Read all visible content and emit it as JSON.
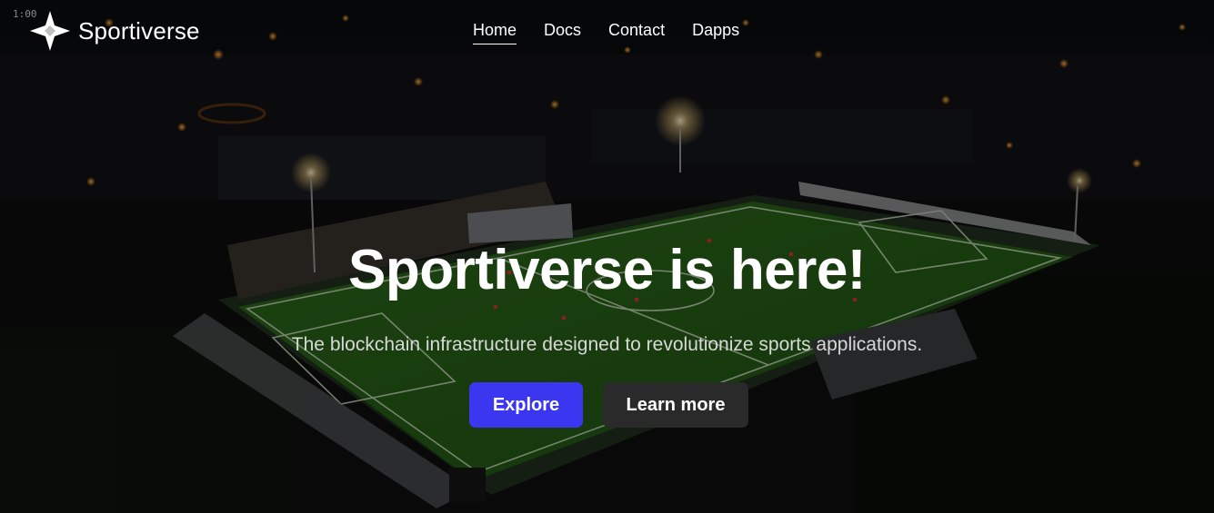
{
  "overlay_timestamp": "1:00",
  "brand": {
    "name": "Sportiverse",
    "logo_icon": "four-point-star-icon"
  },
  "nav": {
    "items": [
      {
        "label": "Home",
        "active": true
      },
      {
        "label": "Docs",
        "active": false
      },
      {
        "label": "Contact",
        "active": false
      },
      {
        "label": "Dapps",
        "active": false
      }
    ]
  },
  "hero": {
    "title": "Sportiverse is here!",
    "subtitle": "The blockchain infrastructure designed to revolutionize sports applications.",
    "primary_button": "Explore",
    "secondary_button": "Learn more",
    "background": "aerial-night-football-stadium-photo"
  },
  "colors": {
    "accent": "#3b37f0",
    "secondary_button": "#2a2a2a",
    "text": "#ffffff"
  }
}
